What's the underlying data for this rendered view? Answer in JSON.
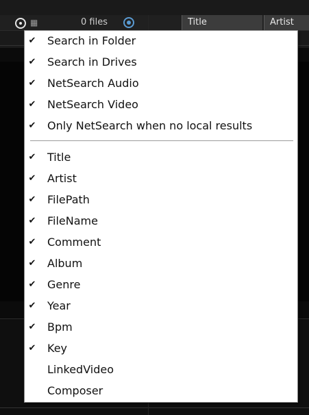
{
  "toolbar": {
    "files_count": "0 files",
    "icons": [
      "search-toggle-icon",
      "grid-icon",
      "files-target-icon"
    ]
  },
  "columns": [
    {
      "label": "Title"
    },
    {
      "label": "Artist"
    }
  ],
  "menu": {
    "items": [
      {
        "label": "Search in Folder",
        "checked": true
      },
      {
        "label": "Search in Drives",
        "checked": true
      },
      {
        "label": "NetSearch Audio",
        "checked": true
      },
      {
        "label": "NetSearch Video",
        "checked": true
      },
      {
        "label": "Only NetSearch when no local results",
        "checked": true
      }
    ],
    "fields": [
      {
        "label": "Title",
        "checked": true
      },
      {
        "label": "Artist",
        "checked": true
      },
      {
        "label": "FilePath",
        "checked": true
      },
      {
        "label": "FileName",
        "checked": true
      },
      {
        "label": "Comment",
        "checked": true
      },
      {
        "label": "Album",
        "checked": true
      },
      {
        "label": "Genre",
        "checked": true
      },
      {
        "label": "Year",
        "checked": true
      },
      {
        "label": "Bpm",
        "checked": true
      },
      {
        "label": "Key",
        "checked": true
      },
      {
        "label": "LinkedVideo",
        "checked": false
      },
      {
        "label": "Composer",
        "checked": false
      }
    ]
  }
}
